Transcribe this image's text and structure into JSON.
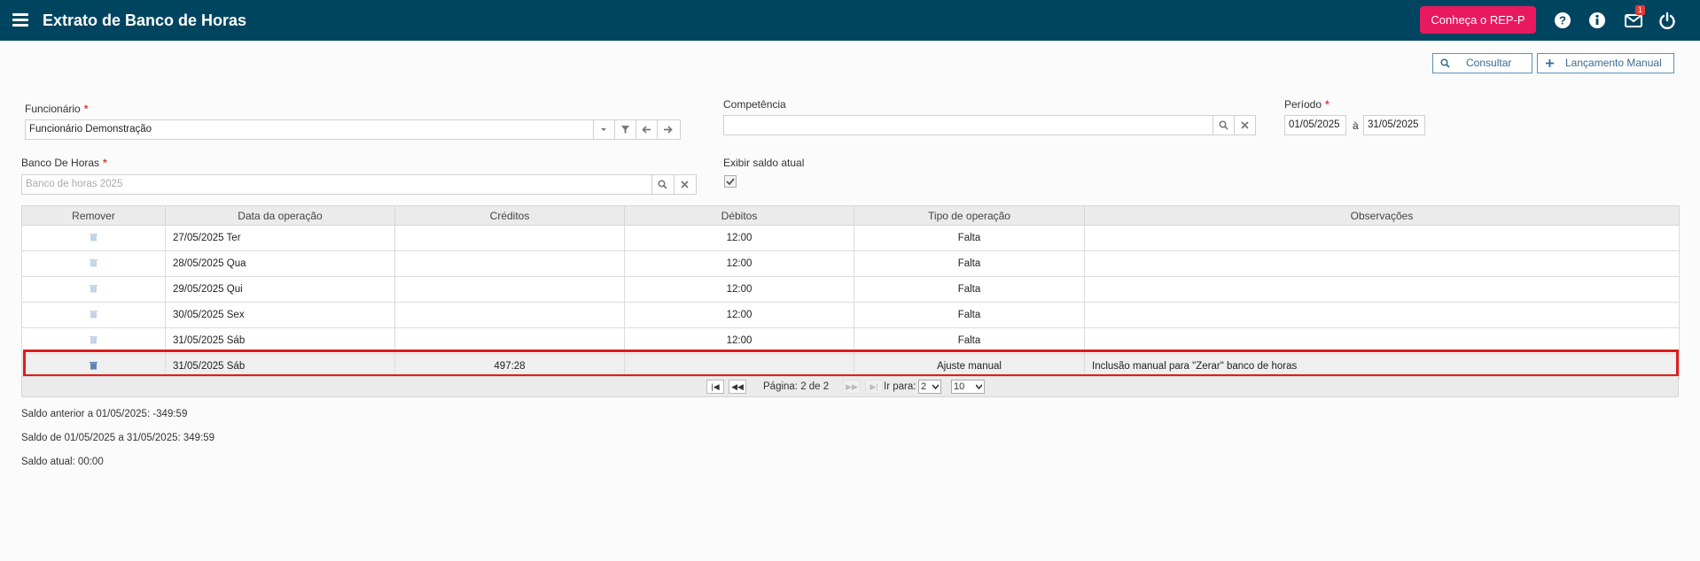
{
  "header": {
    "title": "Extrato de Banco de Horas",
    "rep_button": "Conheça o REP-P",
    "mail_badge": "1"
  },
  "toolbar": {
    "consultar": "Consultar",
    "lancamento": "Lançamento Manual"
  },
  "form": {
    "funcionario_label": "Funcionário",
    "funcionario_value": "Funcionário Demonstração",
    "competencia_label": "Competência",
    "competencia_value": "",
    "periodo_label": "Período",
    "periodo_start": "01/05/2025",
    "periodo_sep": "à",
    "periodo_end": "31/05/2025",
    "banco_label": "Banco De Horas",
    "banco_placeholder": "Banco de horas 2025",
    "exibir_label": "Exibir saldo atual",
    "required_mark": "*"
  },
  "table": {
    "columns": [
      "Remover",
      "Data da operação",
      "Créditos",
      "Débitos",
      "Tipo de operação",
      "Observações"
    ],
    "rows": [
      {
        "data": "27/05/2025 Ter",
        "creditos": "",
        "debitos": "12:00",
        "tipo": "Falta",
        "obs": ""
      },
      {
        "data": "28/05/2025 Qua",
        "creditos": "",
        "debitos": "12:00",
        "tipo": "Falta",
        "obs": ""
      },
      {
        "data": "29/05/2025 Qui",
        "creditos": "",
        "debitos": "12:00",
        "tipo": "Falta",
        "obs": ""
      },
      {
        "data": "30/05/2025 Sex",
        "creditos": "",
        "debitos": "12:00",
        "tipo": "Falta",
        "obs": ""
      },
      {
        "data": "31/05/2025 Sáb",
        "creditos": "",
        "debitos": "12:00",
        "tipo": "Falta",
        "obs": ""
      },
      {
        "data": "31/05/2025 Sáb",
        "creditos": "497:28",
        "debitos": "",
        "tipo": "Ajuste manual",
        "obs": "Inclusão manual para \"Zerar\" banco de horas"
      }
    ]
  },
  "pager": {
    "page_text": "Página: 2 de 2",
    "goto_label": "Ir para:",
    "goto_value": "2",
    "size_value": "10"
  },
  "summary": {
    "saldo_anterior": "Saldo anterior a 01/05/2025: -349:59",
    "saldo_periodo": "Saldo de 01/05/2025 a 31/05/2025: 349:59",
    "saldo_atual": "Saldo atual: 00:00"
  },
  "colors": {
    "topbar": "#004560",
    "accent": "#e8195f",
    "highlight": "#e21b1b"
  }
}
